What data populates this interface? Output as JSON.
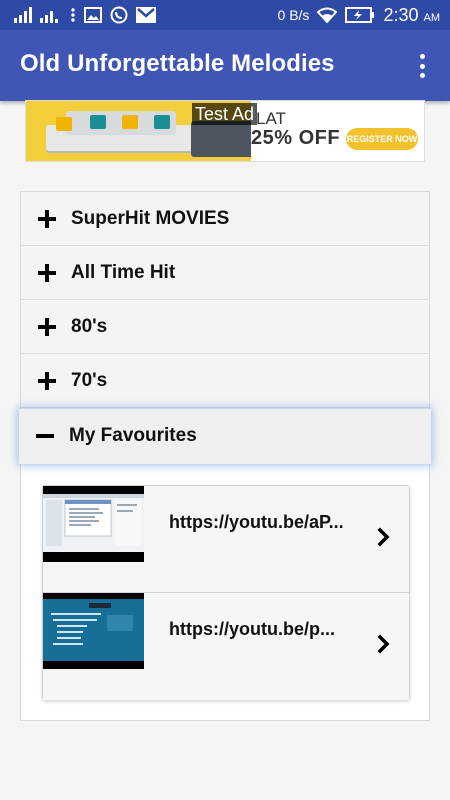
{
  "status_bar": {
    "network_speed": "0 B/s",
    "time": "2:30",
    "ampm": "AM",
    "icons": [
      "signal-icon",
      "signal-icon",
      "more-dots-icon",
      "image-icon",
      "whatsapp-icon",
      "gmail-icon",
      "wifi-icon",
      "battery-icon"
    ]
  },
  "app_bar": {
    "title": "Old Unforgettable Melodies",
    "overflow_icon": "more-vert-icon"
  },
  "ad": {
    "label": "Test Ad",
    "headline_fragment": "LAT",
    "offer": "25% OFF",
    "cta": "REGISTER NOW"
  },
  "accordion": {
    "items": [
      {
        "label": "SuperHit MOVIES",
        "expanded": false
      },
      {
        "label": "All Time Hit",
        "expanded": false
      },
      {
        "label": "80's",
        "expanded": false
      },
      {
        "label": "70's",
        "expanded": false
      },
      {
        "label": "My Favourites",
        "expanded": true
      }
    ]
  },
  "favourites": [
    {
      "url": "https://youtu.be/aP..."
    },
    {
      "url": "https://youtu.be/p..."
    }
  ],
  "colors": {
    "status_bar": "#2f4aa6",
    "app_bar": "#3f56b5",
    "background": "#f5f5f5"
  }
}
